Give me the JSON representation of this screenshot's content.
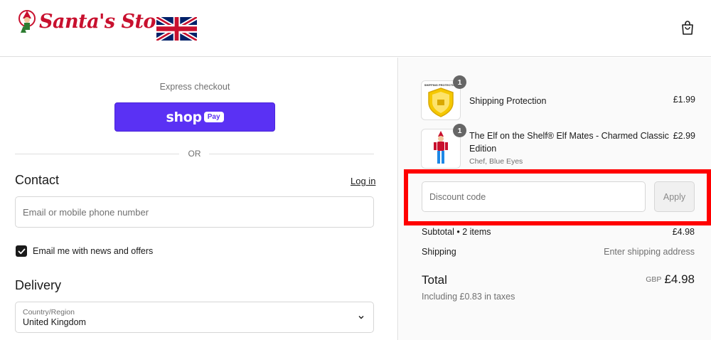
{
  "header": {
    "logo_text": "Santa's Store",
    "icons": {
      "logo": "santa-elf-logo",
      "flag": "uk-flag-icon",
      "cart": "shopping-bag-icon"
    }
  },
  "express": {
    "label": "Express checkout",
    "shop_pay_word": "shop",
    "shop_pay_pill": "Pay",
    "divider": "OR"
  },
  "contact": {
    "heading": "Contact",
    "login_link": "Log in",
    "email_placeholder": "Email or mobile phone number",
    "newsletter_label": "Email me with news and offers",
    "newsletter_checked": true
  },
  "delivery": {
    "heading": "Delivery",
    "country_label": "Country/Region",
    "country_value": "United Kingdom"
  },
  "order": {
    "items": [
      {
        "name": "Shipping Protection",
        "variant": "",
        "price": "£1.99",
        "qty": "1",
        "image_text": "SHIPPING PROTECTION"
      },
      {
        "name_line1": "The Elf on the Shelf® Elf Mates - Charmed Classic",
        "name_line2": "Edition",
        "variant": "Chef, Blue Eyes",
        "price": "£2.99",
        "qty": "1"
      }
    ],
    "discount_placeholder": "Discount code",
    "apply_label": "Apply",
    "subtotal_label": "Subtotal • 2 items",
    "subtotal_value": "£4.98",
    "shipping_label": "Shipping",
    "shipping_value": "Enter shipping address",
    "total_label": "Total",
    "total_currency": "GBP",
    "total_value": "£4.98",
    "tax_note": "Including £0.83 in taxes"
  },
  "colors": {
    "shop_pay": "#5a31f4",
    "highlight": "#ff0000",
    "brand_red": "#c8102e"
  }
}
